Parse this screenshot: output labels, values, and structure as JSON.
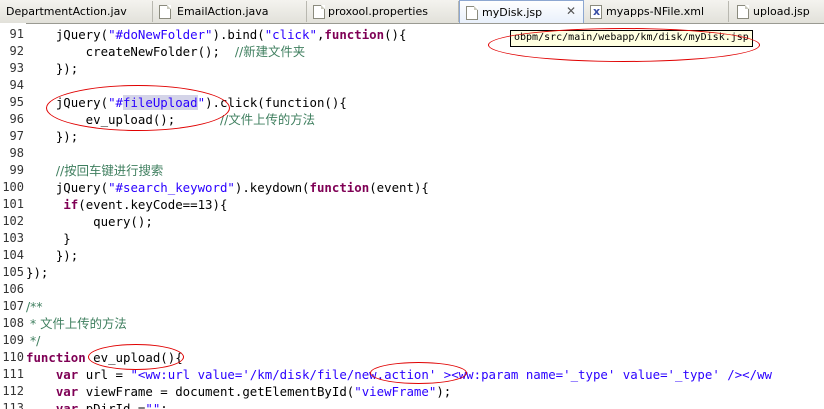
{
  "tabs": [
    {
      "label": "DepartmentAction.jav",
      "icon": "java-file-icon"
    },
    {
      "label": "EmailAction.java",
      "icon": "java-file-icon"
    },
    {
      "label": "proxool.properties",
      "icon": "text-file-icon"
    },
    {
      "label": "myDisk.jsp",
      "icon": "jsp-file-icon",
      "active": true,
      "close": "✕"
    },
    {
      "label": "myapps-NFile.xml",
      "icon": "xml-file-icon"
    },
    {
      "label": "upload.jsp",
      "icon": "jsp-file-icon"
    }
  ],
  "tooltip": "obpm/src/main/webapp/km/disk/myDisk.jsp",
  "line_numbers": [
    "91",
    "92",
    "93",
    "94",
    "95",
    "96",
    "97",
    "98",
    "99",
    "100",
    "101",
    "102",
    "103",
    "104",
    "105",
    "106",
    "107",
    "108",
    "109",
    "110",
    "111",
    "112",
    "113"
  ],
  "code": {
    "l91": {
      "a": "    jQuery(",
      "b": "\"#doNewFolder\"",
      "c": ").bind(",
      "d": "\"click\"",
      "e": ",",
      "f": "function",
      "g": "(){"
    },
    "l92": {
      "a": "        createNewFolder();  ",
      "b": "//新建文件夹"
    },
    "l93": {
      "a": "    });"
    },
    "l94": {
      "a": ""
    },
    "l95": {
      "a": "    jQuery(",
      "b": "\"#",
      "c": "fileUpload",
      "d": "\"",
      "e": ").click(function(){"
    },
    "l96": {
      "a": "        ev_upload();      ",
      "b": "//文件上传的方法"
    },
    "l97": {
      "a": "    });"
    },
    "l98": {
      "a": ""
    },
    "l99": {
      "a": "    ",
      "b": "//按回车键进行搜索"
    },
    "l100": {
      "a": "    jQuery(",
      "b": "\"#search_keyword\"",
      "c": ").keydown(",
      "d": "function",
      "e": "(event){"
    },
    "l101": {
      "a": "     ",
      "b": "if",
      "c": "(event.keyCode==13){"
    },
    "l102": {
      "a": "         query();"
    },
    "l103": {
      "a": "     }"
    },
    "l104": {
      "a": "    });"
    },
    "l105": {
      "a": "});"
    },
    "l106": {
      "a": ""
    },
    "l107": {
      "a": "/**"
    },
    "l108": {
      "a": " * ",
      "b": "文件上传的方法"
    },
    "l109": {
      "a": " */"
    },
    "l110": {
      "a": "function",
      "b": " ev_upload(){"
    },
    "l111": {
      "a": "    ",
      "b": "var",
      "c": " url = ",
      "d": "\"<ww:url value='/km/disk/file/new.action' ><ww:param name='_type' value='_type' /></ww"
    },
    "l112": {
      "a": "    ",
      "b": "var",
      "c": " viewFrame = document.getElementById(",
      "d": "\"viewFrame\"",
      "e": ");"
    },
    "l113": {
      "a": "    ",
      "b": "var",
      "c": " pDirId =",
      "d": "\"\"",
      "e": ";"
    }
  },
  "colors": {
    "keyword": "#7f0055",
    "string": "#2a00ff",
    "comment": "#3f7f5f",
    "annotation": "#e00000",
    "tooltip_bg": "#ffffe1"
  }
}
